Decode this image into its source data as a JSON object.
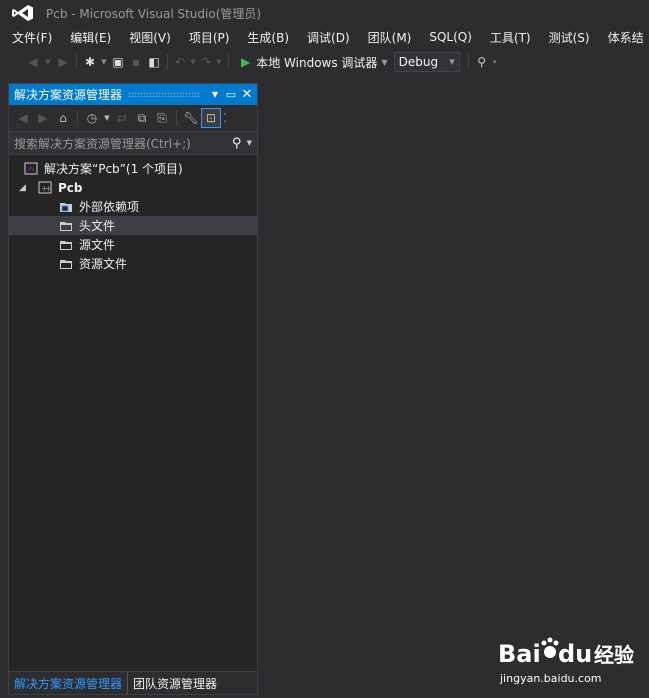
{
  "window": {
    "title": "Pcb - Microsoft Visual Studio(管理员)"
  },
  "menu": [
    "文件(F)",
    "编辑(E)",
    "视图(V)",
    "项目(P)",
    "生成(B)",
    "调试(D)",
    "团队(M)",
    "SQL(Q)",
    "工具(T)",
    "测试(S)",
    "体系结"
  ],
  "toolbar": {
    "start_label": "本地 Windows 调试器",
    "config": "Debug"
  },
  "solution_explorer": {
    "title": "解决方案资源管理器",
    "search_placeholder": "搜索解决方案资源管理器(Ctrl+;)",
    "solution_label": "解决方案“Pcb”(1 个项目)",
    "project_label": "Pcb",
    "folders": [
      "外部依赖项",
      "头文件",
      "源文件",
      "资源文件"
    ],
    "selected_folder": "头文件"
  },
  "bottom_tabs": [
    "解决方案资源管理器",
    "团队资源管理器"
  ],
  "watermark": {
    "brand": "Bai",
    "brand2": "du",
    "product": "经验",
    "url": "jingyan.baidu.com"
  },
  "colors": {
    "accent": "#007acc",
    "background": "#2d2d30",
    "panel": "#252526",
    "start_green": "#3fb950"
  }
}
